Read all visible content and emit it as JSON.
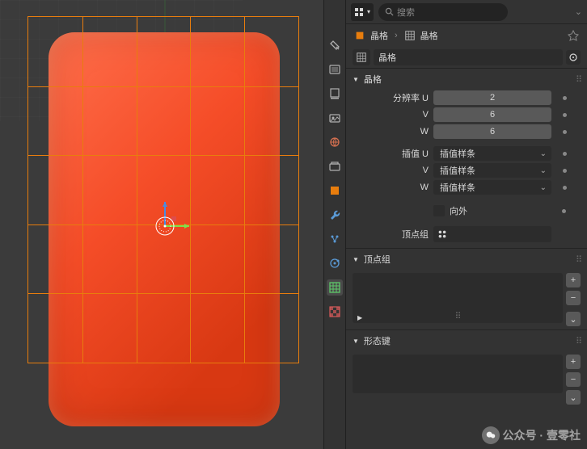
{
  "search": {
    "placeholder": "搜索"
  },
  "breadcrumb": {
    "obj": "晶格",
    "data": "晶格"
  },
  "objectSelect": {
    "name": "晶格"
  },
  "sections": {
    "lattice": {
      "title": "晶格",
      "resU_label": "分辨率 U",
      "resU": "2",
      "resV_label": "V",
      "resV": "6",
      "resW_label": "W",
      "resW": "6",
      "interpU_label": "插值 U",
      "interpU": "插值样条",
      "interpV_label": "V",
      "interpV": "插值样条",
      "interpW_label": "W",
      "interpW": "插值样条",
      "outside_label": "向外",
      "vgroup_label": "顶点组"
    },
    "vgroup": {
      "title": "顶点组"
    },
    "shapekeys": {
      "title": "形态键"
    }
  },
  "watermark": "公众号 · 壹零社"
}
